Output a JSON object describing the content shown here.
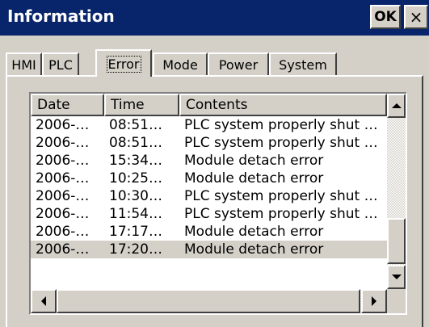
{
  "window": {
    "title": "Information",
    "ok_label": "OK",
    "close_label": "×",
    "colors": {
      "titlebar": "#08246b",
      "face": "#d4d0c8"
    }
  },
  "tabs": [
    {
      "label": "HMI",
      "active": false
    },
    {
      "label": "PLC",
      "active": false
    },
    {
      "label": "Error",
      "active": true
    },
    {
      "label": "Mode",
      "active": false
    },
    {
      "label": "Power",
      "active": false
    },
    {
      "label": "System",
      "active": false
    }
  ],
  "error_list": {
    "columns": [
      "Date",
      "Time",
      "Contents"
    ],
    "rows": [
      {
        "date": "2006-…",
        "time": "08:51…",
        "contents": "PLC system properly shut …",
        "selected": false
      },
      {
        "date": "2006-…",
        "time": "08:51…",
        "contents": "PLC system properly shut …",
        "selected": false
      },
      {
        "date": "2006-…",
        "time": "15:34…",
        "contents": "Module detach error",
        "selected": false
      },
      {
        "date": "2006-…",
        "time": "10:25…",
        "contents": "Module detach error",
        "selected": false
      },
      {
        "date": "2006-…",
        "time": "10:30…",
        "contents": "PLC system properly shut …",
        "selected": false
      },
      {
        "date": "2006-…",
        "time": "11:54…",
        "contents": "PLC system properly shut …",
        "selected": false
      },
      {
        "date": "2006-…",
        "time": "17:17…",
        "contents": "Module detach error",
        "selected": false
      },
      {
        "date": "2006-…",
        "time": "17:20…",
        "contents": "Module detach error",
        "selected": true
      }
    ],
    "scrollbars": {
      "vertical_up_icon": "arrow-up-icon",
      "vertical_down_icon": "arrow-down-icon",
      "horizontal_left_icon": "arrow-left-icon",
      "horizontal_right_icon": "arrow-right-icon",
      "vertical_scroll_position": 1.0,
      "horizontal_scroll_position": 0.0
    }
  }
}
